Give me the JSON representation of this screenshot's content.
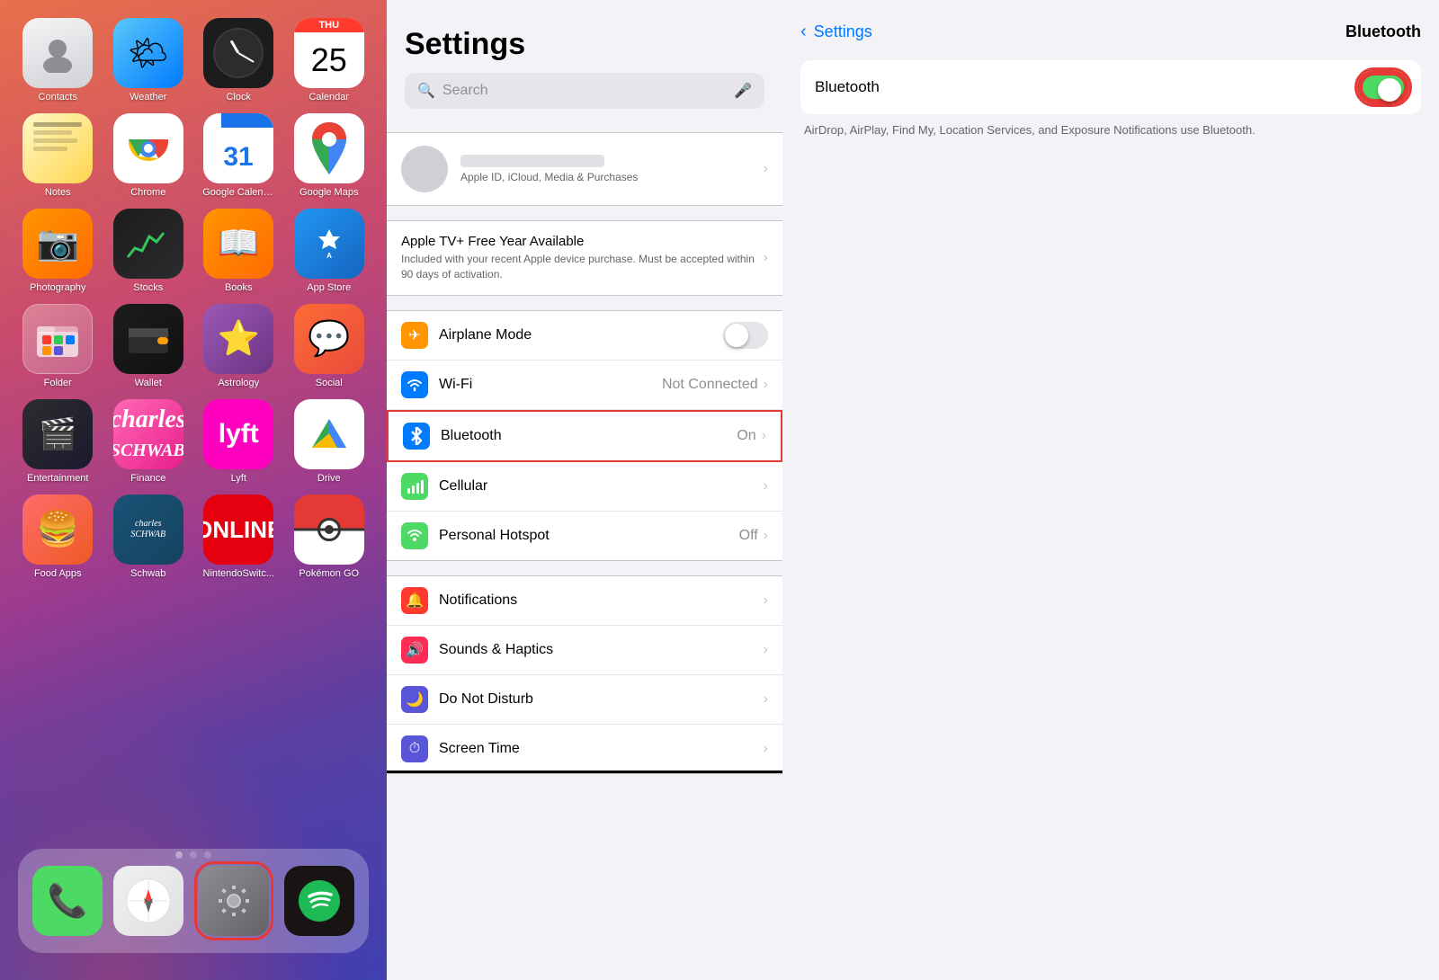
{
  "iphone": {
    "apps": [
      {
        "id": "contacts",
        "label": "Contacts",
        "icon_class": "icon-contacts",
        "emoji": "👤"
      },
      {
        "id": "weather",
        "label": "Weather",
        "icon_class": "icon-weather",
        "emoji": "🌤"
      },
      {
        "id": "clock",
        "label": "Clock",
        "icon_class": "icon-clock",
        "emoji": "🕐"
      },
      {
        "id": "calendar",
        "label": "Calendar",
        "icon_class": "icon-calendar",
        "emoji": "📅"
      },
      {
        "id": "notes",
        "label": "Notes",
        "icon_class": "icon-notes",
        "emoji": "📝"
      },
      {
        "id": "chrome",
        "label": "Chrome",
        "icon_class": "icon-chrome",
        "emoji": "🌐"
      },
      {
        "id": "gcalendar",
        "label": "Google Calendar",
        "icon_class": "icon-gcalendar",
        "emoji": "📅"
      },
      {
        "id": "gmaps",
        "label": "Google Maps",
        "icon_class": "icon-gmaps",
        "emoji": "🗺"
      },
      {
        "id": "photography",
        "label": "Photography",
        "icon_class": "icon-photography",
        "emoji": "📷"
      },
      {
        "id": "stocks",
        "label": "Stocks",
        "icon_class": "icon-stocks",
        "emoji": "📈"
      },
      {
        "id": "books",
        "label": "Books",
        "icon_class": "icon-books",
        "emoji": "📖"
      },
      {
        "id": "appstore",
        "label": "App Store",
        "icon_class": "icon-appstore",
        "emoji": ""
      },
      {
        "id": "folder",
        "label": "Folder",
        "icon_class": "icon-folder",
        "emoji": "📁"
      },
      {
        "id": "wallet",
        "label": "Wallet",
        "icon_class": "icon-wallet",
        "emoji": "👛"
      },
      {
        "id": "astrology",
        "label": "Astrology",
        "icon_class": "icon-astrology",
        "emoji": "⭐"
      },
      {
        "id": "social",
        "label": "Social",
        "icon_class": "icon-social",
        "emoji": "💬"
      },
      {
        "id": "entertainment",
        "label": "Entertainment",
        "icon_class": "icon-entertainment",
        "emoji": "🎬"
      },
      {
        "id": "finance",
        "label": "Finance",
        "icon_class": "icon-finance",
        "emoji": "💰"
      },
      {
        "id": "lyft",
        "label": "Lyft",
        "icon_class": "icon-lyft",
        "emoji": "L"
      },
      {
        "id": "drive",
        "label": "Drive",
        "icon_class": "icon-drive",
        "emoji": "▲"
      },
      {
        "id": "foodapps",
        "label": "Food Apps",
        "icon_class": "icon-foodapps",
        "emoji": "🍔"
      },
      {
        "id": "schwab",
        "label": "Schwab",
        "icon_class": "icon-schwab",
        "emoji": "S"
      },
      {
        "id": "nintendo",
        "label": "NintendoSwitc...",
        "icon_class": "icon-nintendo",
        "emoji": "🎮"
      },
      {
        "id": "pokemon",
        "label": "Pokémon GO",
        "icon_class": "icon-pokemon",
        "emoji": "⚪"
      }
    ],
    "dock": [
      {
        "id": "phone",
        "label": "Phone",
        "icon_class": "icon-phone",
        "emoji": "📞"
      },
      {
        "id": "safari",
        "label": "Safari",
        "icon_class": "icon-safari",
        "emoji": "🧭"
      },
      {
        "id": "settings",
        "label": "Settings",
        "icon_class": "icon-settings",
        "emoji": "⚙️",
        "highlighted": true
      },
      {
        "id": "spotify",
        "label": "Spotify",
        "icon_class": "icon-spotify",
        "emoji": "🎵"
      }
    ]
  },
  "settings": {
    "title": "Settings",
    "search_placeholder": "Search",
    "apple_id_sub": "Apple ID, iCloud, Media & Purchases",
    "promo_title": "Apple TV+ Free Year Available",
    "promo_sub": "Included with your recent Apple device purchase.\nMust be accepted within 90 days of activation.",
    "rows": [
      {
        "id": "airplane",
        "label": "Airplane Mode",
        "icon_class": "airplane",
        "type": "toggle",
        "value": false
      },
      {
        "id": "wifi",
        "label": "Wi-Fi",
        "icon_class": "wifi",
        "type": "value",
        "value": "Not Connected"
      },
      {
        "id": "bluetooth",
        "label": "Bluetooth",
        "icon_class": "bluetooth",
        "type": "value",
        "value": "On",
        "highlighted": true
      },
      {
        "id": "cellular",
        "label": "Cellular",
        "icon_class": "cellular",
        "type": "chevron"
      },
      {
        "id": "hotspot",
        "label": "Personal Hotspot",
        "icon_class": "hotspot",
        "type": "value",
        "value": "Off"
      }
    ],
    "rows2": [
      {
        "id": "notifications",
        "label": "Notifications",
        "icon_class": "notifications",
        "type": "chevron"
      },
      {
        "id": "sounds",
        "label": "Sounds & Haptics",
        "icon_class": "sounds",
        "type": "chevron"
      },
      {
        "id": "dnd",
        "label": "Do Not Disturb",
        "icon_class": "dnd",
        "type": "chevron"
      },
      {
        "id": "screentime",
        "label": "Screen Time",
        "icon_class": "screentime",
        "type": "chevron"
      }
    ]
  },
  "bluetooth": {
    "back_label": "Settings",
    "page_title": "Bluetooth",
    "toggle_label": "Bluetooth",
    "toggle_on": true,
    "description": "AirDrop, AirPlay, Find My, Location Services, and Exposure Notifications use Bluetooth."
  }
}
